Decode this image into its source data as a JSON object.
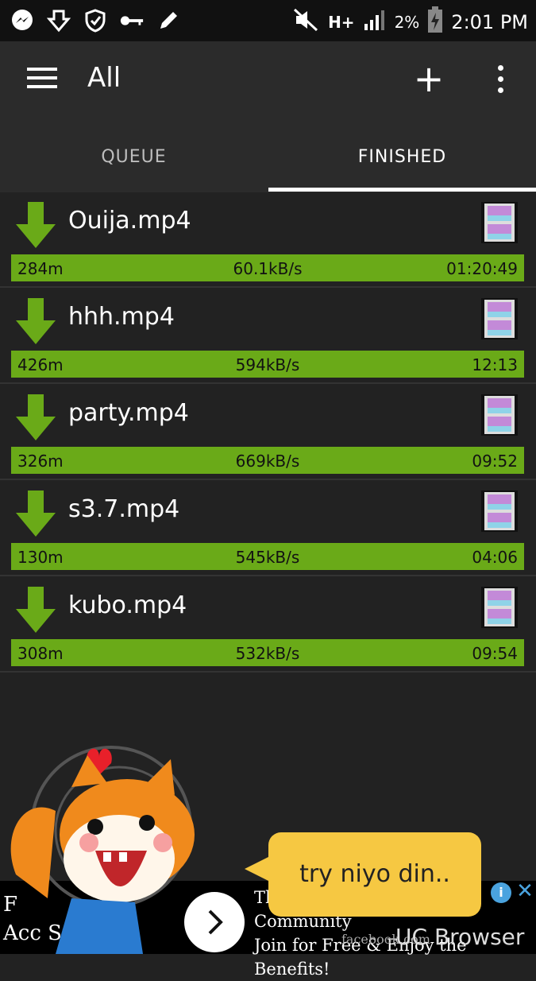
{
  "status": {
    "network": "H+",
    "battery_pct": "2%",
    "time": "2:01 PM"
  },
  "appbar": {
    "title": "All"
  },
  "tabs": [
    {
      "label": "QUEUE"
    },
    {
      "label": "FINISHED"
    }
  ],
  "downloads": [
    {
      "name": "Ouija.mp4",
      "size": "284m",
      "speed": "60.1kB/s",
      "time": "01:20:49"
    },
    {
      "name": "hhh.mp4",
      "size": "426m",
      "speed": "594kB/s",
      "time": "12:13"
    },
    {
      "name": "party.mp4",
      "size": "326m",
      "speed": "669kB/s",
      "time": "09:52"
    },
    {
      "name": "s3.7.mp4",
      "size": "130m",
      "speed": "545kB/s",
      "time": "04:06"
    },
    {
      "name": "kubo.mp4",
      "size": "308m",
      "speed": "532kB/s",
      "time": "09:54"
    }
  ],
  "promo": {
    "bubble_text": "try niyo din.."
  },
  "ad": {
    "left_line1": "F",
    "left_line2": "Acc   Sign Up",
    "text_line1": "The World's #1 Online Community",
    "text_line2": "Join for Free & Enjoy the Benefits!",
    "domain": "facebook.com",
    "brand": "UC Browser"
  },
  "colors": {
    "progress": "#6aaa18",
    "arrow": "#6aaa18",
    "bubble": "#f6c842"
  }
}
